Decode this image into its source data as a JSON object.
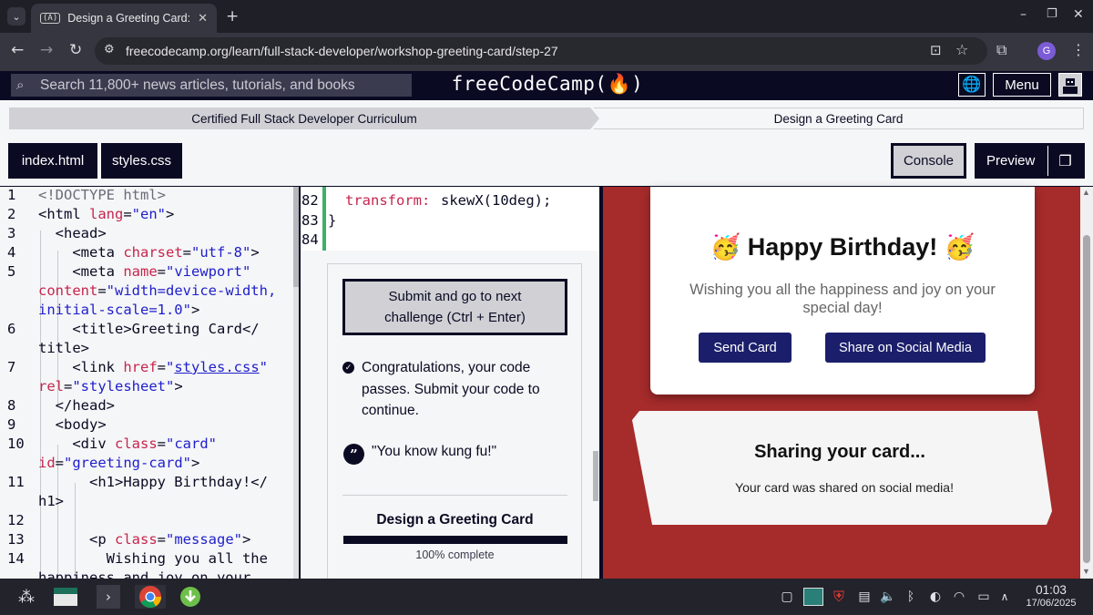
{
  "browser": {
    "tab_title": "Design a Greeting Card: Ste",
    "tab_favicon": "(A)",
    "url": "freecodecamp.org/learn/full-stack-developer/workshop-greeting-card/step-27",
    "profile_initial": "G"
  },
  "fcc_header": {
    "search_placeholder": "Search 11,800+ news articles, tutorials, and books",
    "logo": "freeCodeCamp(🔥)",
    "menu_label": "Menu"
  },
  "breadcrumbs": {
    "curriculum": "Certified Full Stack Developer Curriculum",
    "workshop": "Design a Greeting Card"
  },
  "toolbar": {
    "file_tabs": [
      "index.html",
      "styles.css"
    ],
    "console_label": "Console",
    "preview_label": "Preview"
  },
  "editor": {
    "line_numbers": [
      "1",
      "2",
      "3",
      "4",
      "5",
      "",
      "6",
      "",
      "7",
      "",
      "8",
      "9",
      "10",
      "",
      "11",
      "",
      "12",
      "13",
      "14"
    ]
  },
  "css_editor": {
    "line_numbers": [
      "82",
      "83",
      "84"
    ],
    "line82_prop": "transform:",
    "line82_val": "skewX(10deg);",
    "line83": "}"
  },
  "panel": {
    "submit_label": "Submit and go to next challenge (Ctrl + Enter)",
    "pass_message": "Congratulations, your code passes. Submit your code to continue.",
    "quote": "\"You know kung fu!\"",
    "progress_title": "Design a Greeting Card",
    "progress_percent": 100,
    "progress_text": "100% complete"
  },
  "preview": {
    "heading": "🥳 Happy Birthday! 🥳",
    "message": "Wishing you all the happiness and joy on your special day!",
    "send_button": "Send Card",
    "share_button": "Share on Social Media",
    "share_title": "Sharing your card...",
    "share_message": "Your card was shared on social media!"
  },
  "taskbar": {
    "time": "01:03",
    "date": "17/06/2025"
  },
  "colors": {
    "fcc_dark": "#0a0a23",
    "preview_bg": "#a62b2b",
    "button_navy": "#1b1f6b",
    "editor_green": "#3eb06a"
  }
}
